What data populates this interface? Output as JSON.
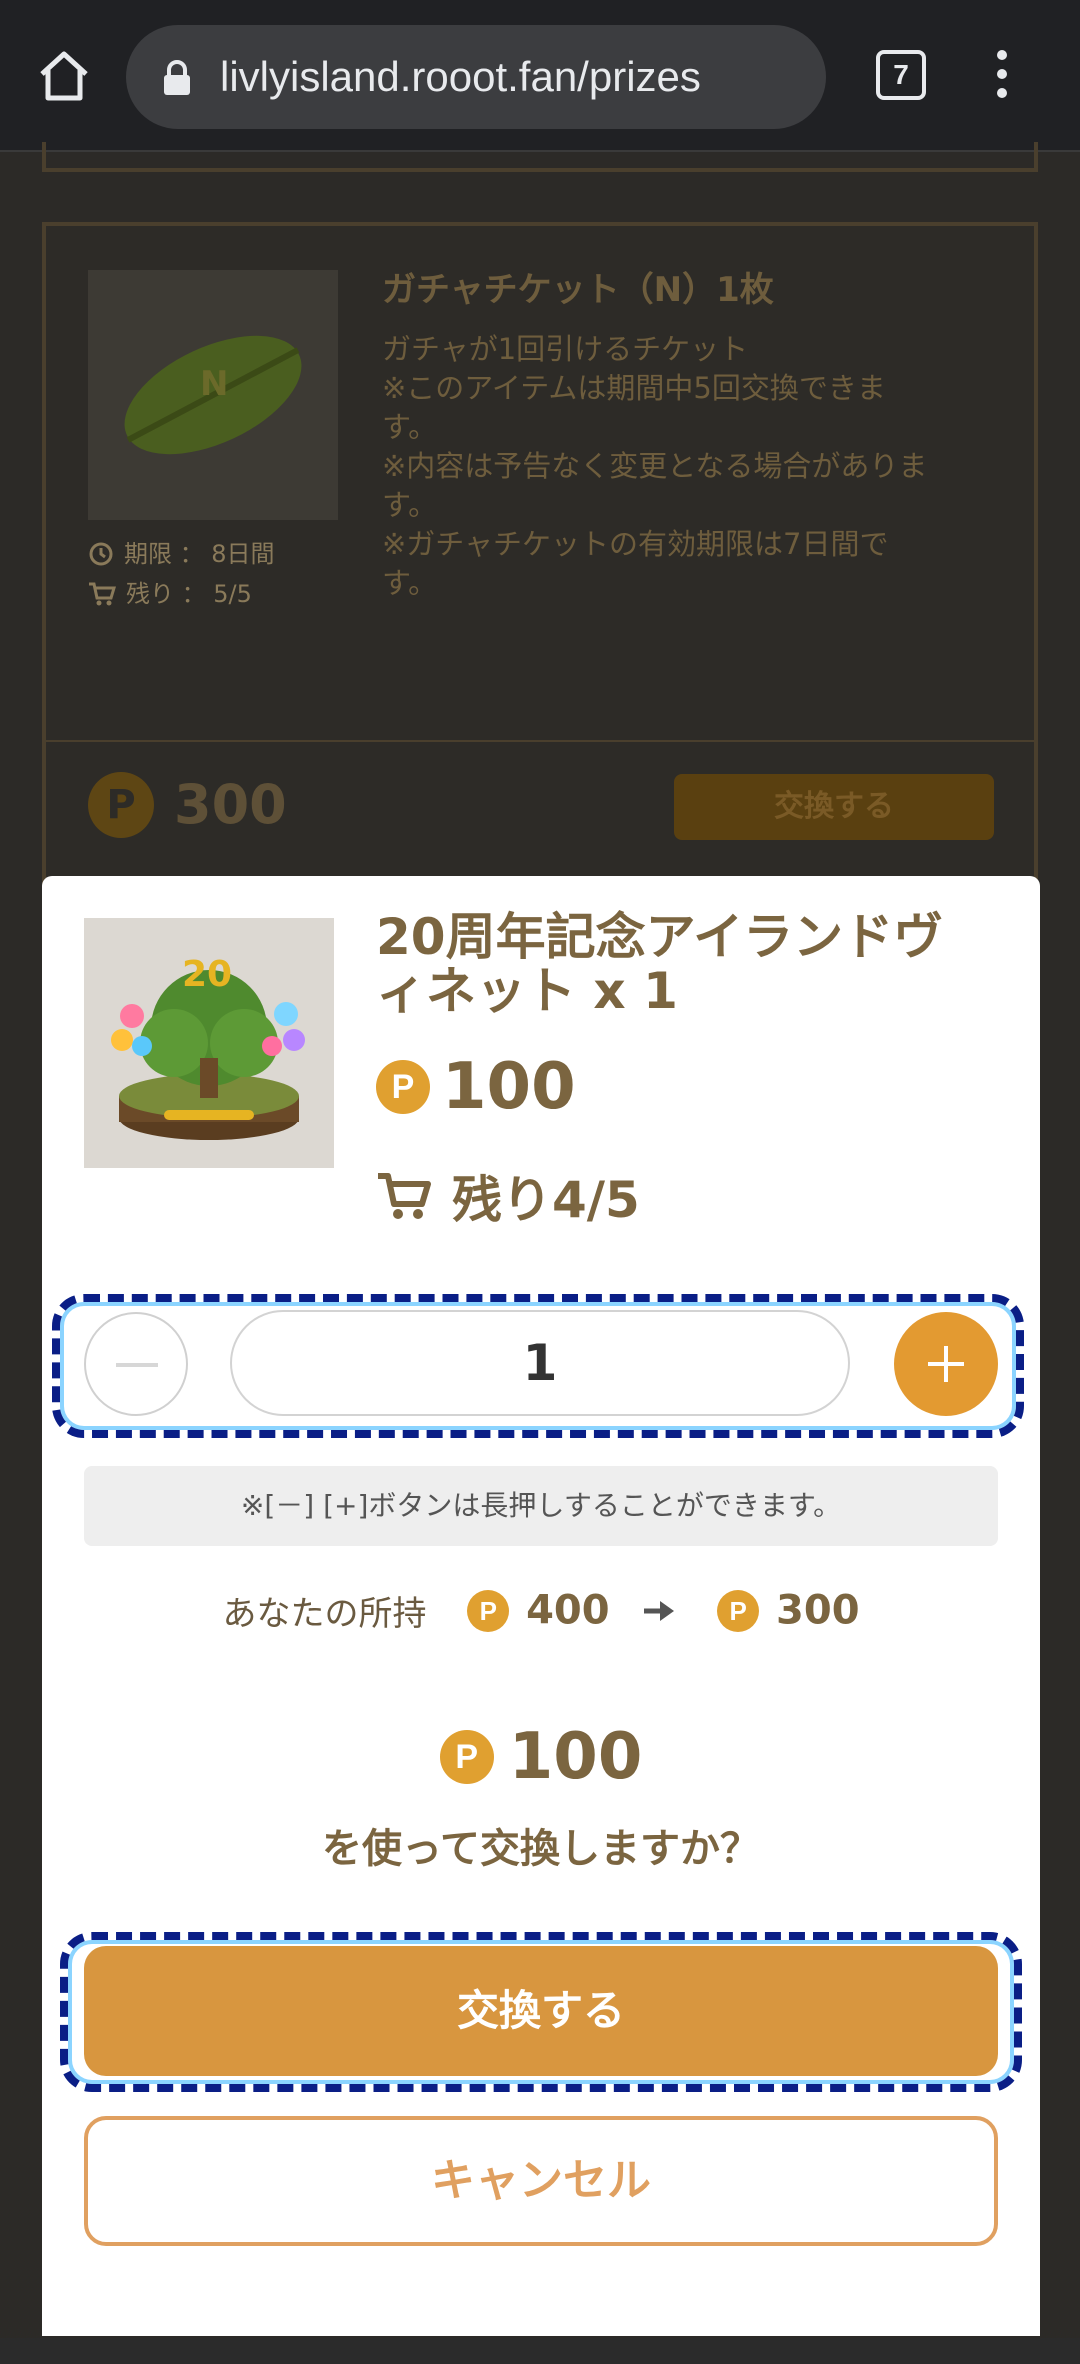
{
  "browser": {
    "url": "livlyisland.rooot.fan/prizes",
    "tab_count": "7"
  },
  "background_card": {
    "title": "ガチャチケット（N）1枚",
    "description": [
      "ガチャが1回引けるチケット",
      "※このアイテムは期間中5回交換できま",
      "す。",
      "※内容は予告なく変更となる場合がありま",
      "す。",
      "※ガチャチケットの有効期限は7日間で",
      "す。"
    ],
    "period": "期限 ： 8日間",
    "stock": "残り ： 5/5",
    "price": "300",
    "exchange_label": "交換する"
  },
  "modal": {
    "title_line1": "20周年記念アイランドヴ",
    "title_line2": "ィネット x 1",
    "coin_symbol": "P",
    "price": "100",
    "stock": "残り4/5",
    "quantity": "1",
    "hint": "※[－] [+]ボタンは長押しすることができます。",
    "balance_label": "あなたの所持",
    "balance_before": "400",
    "balance_after": "300",
    "total": "100",
    "question": "を使って交換しますか？",
    "exchange_label": "交換する",
    "cancel_label": "キャンセル"
  },
  "colors": {
    "accent": "#d8963f",
    "coin": "#e0a030",
    "text_brown": "#7b6540",
    "focus_ring": "#0a1e86"
  }
}
